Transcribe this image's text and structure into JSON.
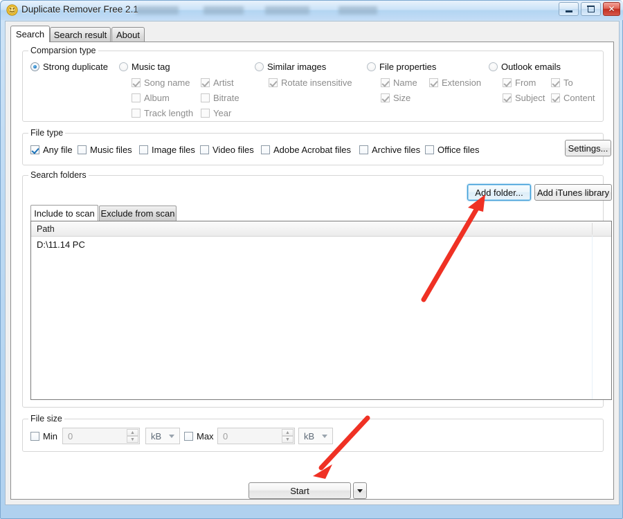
{
  "window": {
    "title": "Duplicate Remover Free 2.1",
    "icon": "app-icon",
    "controls": {
      "minimize": "–",
      "maximize": "□",
      "close": "✕"
    }
  },
  "tabs": [
    {
      "label": "Search",
      "active": true
    },
    {
      "label": "Search result",
      "active": false
    },
    {
      "label": "About",
      "active": false
    }
  ],
  "comparison_group": {
    "label": "Comparsion type",
    "options": [
      {
        "label": "Strong duplicate",
        "selected": true
      },
      {
        "label": "Music tag",
        "selected": false
      },
      {
        "label": "Similar images",
        "selected": false
      },
      {
        "label": "File properties",
        "selected": false
      },
      {
        "label": "Outlook emails",
        "selected": false
      }
    ],
    "music_tag_options": [
      {
        "label": "Song name",
        "checked": true
      },
      {
        "label": "Artist",
        "checked": true
      },
      {
        "label": "Album",
        "checked": false
      },
      {
        "label": "Bitrate",
        "checked": false
      },
      {
        "label": "Track length",
        "checked": false
      },
      {
        "label": "Year",
        "checked": false
      }
    ],
    "similar_images_options": [
      {
        "label": "Rotate insensitive",
        "checked": true
      }
    ],
    "file_properties_options": [
      {
        "label": "Name",
        "checked": true
      },
      {
        "label": "Extension",
        "checked": true
      },
      {
        "label": "Size",
        "checked": true
      }
    ],
    "outlook_options": [
      {
        "label": "From",
        "checked": true
      },
      {
        "label": "To",
        "checked": true
      },
      {
        "label": "Subject",
        "checked": true
      },
      {
        "label": "Content",
        "checked": true
      }
    ]
  },
  "file_type_group": {
    "label": "File type",
    "items": [
      {
        "label": "Any file",
        "checked": true
      },
      {
        "label": "Music files",
        "checked": false
      },
      {
        "label": "Image files",
        "checked": false
      },
      {
        "label": "Video files",
        "checked": false
      },
      {
        "label": "Adobe Acrobat files",
        "checked": false
      },
      {
        "label": "Archive files",
        "checked": false
      },
      {
        "label": "Office files",
        "checked": false
      }
    ],
    "settings_button": "Settings..."
  },
  "search_folders_group": {
    "label": "Search folders",
    "add_folder_button": "Add folder...",
    "add_itunes_button": "Add iTunes library",
    "subtabs": [
      {
        "label": "Include to scan",
        "active": true
      },
      {
        "label": "Exclude from scan",
        "active": false
      }
    ],
    "list": {
      "columns": [
        "Path"
      ],
      "rows": [
        {
          "path": "D:\\11.14 PC"
        }
      ]
    }
  },
  "file_size_group": {
    "label": "File size",
    "min": {
      "label": "Min",
      "checked": false,
      "value": "0",
      "unit": "kB"
    },
    "max": {
      "label": "Max",
      "checked": false,
      "value": "0",
      "unit": "kB"
    }
  },
  "actions": {
    "start_button": "Start",
    "start_dropdown": "▼"
  },
  "annotations": {
    "arrow_color": "#ef3124",
    "arrow1_target": "Add folder...",
    "arrow2_target": "Start"
  }
}
